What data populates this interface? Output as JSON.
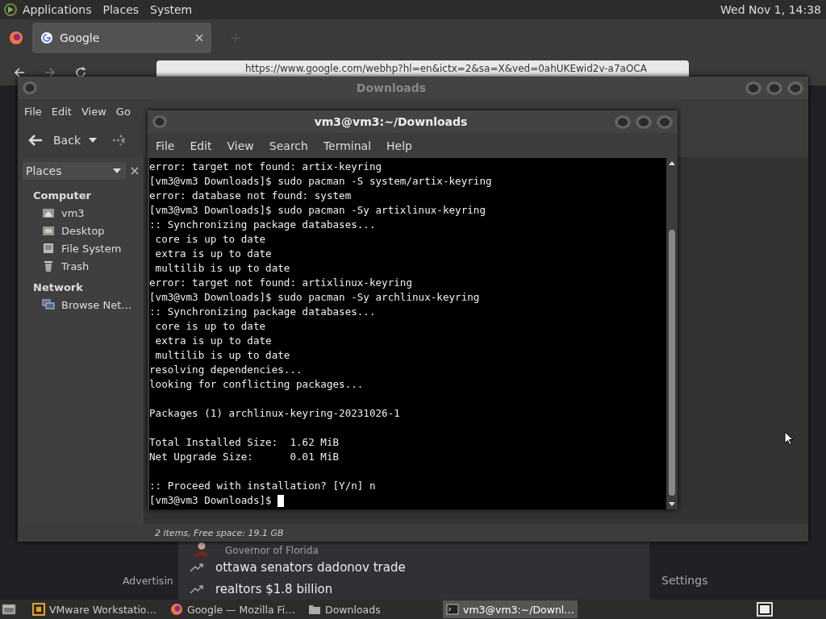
{
  "top_panel": {
    "menus": [
      "Applications",
      "Places",
      "System"
    ],
    "clock": "Wed Nov 1, 14:38"
  },
  "browser": {
    "tab": {
      "title": "Google",
      "selected": true
    },
    "url": "https://www.google.com/webhp?hl=en&ictx=2&sa=X&ved=0ahUKEwid2v-a7aOCA",
    "page": {
      "suggestions": [
        {
          "kind": "person",
          "text": "Governor of Florida"
        },
        {
          "kind": "trend",
          "text": "ottawa senators dadonov trade"
        },
        {
          "kind": "trend",
          "text": "realtors $1.8 billion"
        }
      ],
      "footer_left": "Advertisin",
      "footer_right": "Settings"
    }
  },
  "file_manager": {
    "title": "Downloads",
    "menu": [
      "File",
      "Edit",
      "View",
      "Go"
    ],
    "back": "Back",
    "sidebar": {
      "header": "Places",
      "sections": [
        {
          "title": "Computer",
          "items": [
            {
              "label": "vm3",
              "kind": "home"
            },
            {
              "label": "Desktop",
              "kind": "desktop"
            },
            {
              "label": "File System",
              "kind": "drive"
            },
            {
              "label": "Trash",
              "kind": "trash"
            }
          ]
        },
        {
          "title": "Network",
          "items": [
            {
              "label": "Browse Net…",
              "kind": "network"
            }
          ]
        }
      ]
    },
    "status": "2 items, Free space: 19.1 GB"
  },
  "terminal": {
    "title": "vm3@vm3:~/Downloads",
    "menu": [
      "File",
      "Edit",
      "View",
      "Search",
      "Terminal",
      "Help"
    ],
    "blocks": [
      [
        "error: target not found: artix-keyring",
        "[vm3@vm3 Downloads]$ sudo pacman -S system/artix-keyring",
        "error: database not found: system",
        "[vm3@vm3 Downloads]$ sudo pacman -Sy artixlinux-keyring",
        ":: Synchronizing package databases...",
        " core is up to date",
        " extra is up to date",
        " multilib is up to date",
        "error: target not found: artixlinux-keyring",
        "[vm3@vm3 Downloads]$ sudo pacman -Sy archlinux-keyring",
        ":: Synchronizing package databases...",
        " core is up to date",
        " extra is up to date",
        " multilib is up to date",
        "resolving dependencies...",
        "looking for conflicting packages..."
      ],
      [
        "Packages (1) archlinux-keyring-20231026-1"
      ],
      [
        "Total Installed Size:  1.62 MiB",
        "Net Upgrade Size:      0.01 MiB"
      ],
      [
        ":: Proceed with installation? [Y/n] n",
        "[vm3@vm3 Downloads]$ "
      ]
    ]
  },
  "taskbar": {
    "items": [
      {
        "label": "VMware Workstatio…",
        "kind": "vmware",
        "selected": false
      },
      {
        "label": "Google — Mozilla Fi…",
        "kind": "firefox",
        "selected": false
      },
      {
        "label": "Downloads",
        "kind": "folder",
        "selected": false
      },
      {
        "label": "vm3@vm3:~/Downl…",
        "kind": "terminal",
        "selected": true
      }
    ]
  }
}
